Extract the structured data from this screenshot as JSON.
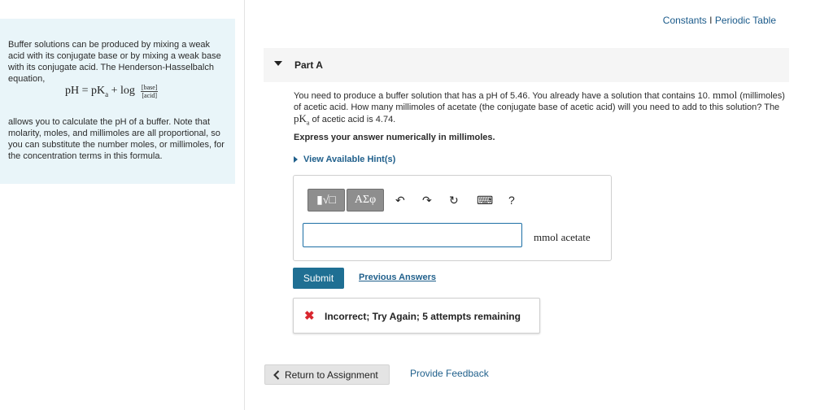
{
  "intro": {
    "text_before": "Buffer solutions can be produced by mixing a weak acid with its conjugate base or by mixing a weak base with its conjugate acid. The Henderson-Hasselbalch equation,",
    "formula_lhs": "pH = pK",
    "formula_sub": "a",
    "formula_mid": " + log ",
    "formula_num": "[base]",
    "formula_den": "[acid]",
    "text_after": "allows you to calculate the pH of a buffer. Note that molarity, moles, and millimoles are all proportional, so you can substitute the number moles, or millimoles, for the concentration terms in this formula."
  },
  "top_links": {
    "constants": "Constants",
    "separator": " I ",
    "periodic_table": "Periodic Table"
  },
  "part": {
    "title": "Part A",
    "question_1": "You need to produce a buffer solution that has a pH of 5.46. You already have a solution that contains 10.",
    "question_unit": "mmol",
    "question_2": "(millimoles) of acetic acid. How many millimoles of acetate (the conjugate base of acetic acid) will you need to add to this solution? The",
    "question_pka": "pK",
    "question_pka_sub": "a",
    "question_3": "of acetic acid is 4.74.",
    "express": "Express your answer numerically in millimoles.",
    "hints_label": "View Available Hint(s)"
  },
  "toolbar": {
    "templates_label": "▮√□",
    "greek_label": "ΑΣφ",
    "undo_glyph": "↶",
    "redo_glyph": "↷",
    "reset_glyph": "↻",
    "keyboard_glyph": "⌨",
    "help_glyph": "?"
  },
  "answer": {
    "value": "",
    "unit": "mmol acetate"
  },
  "actions": {
    "submit": "Submit",
    "previous_answers": "Previous Answers"
  },
  "feedback": {
    "icon": "✖",
    "message": "Incorrect; Try Again; 5 attempts remaining"
  },
  "footer": {
    "return_label": "Return to Assignment",
    "provide_feedback": "Provide Feedback"
  },
  "colors": {
    "intro_bg": "#e9f5f9",
    "link": "#1f5f8b",
    "submit_bg": "#1f6f93",
    "error": "#d9262e"
  }
}
